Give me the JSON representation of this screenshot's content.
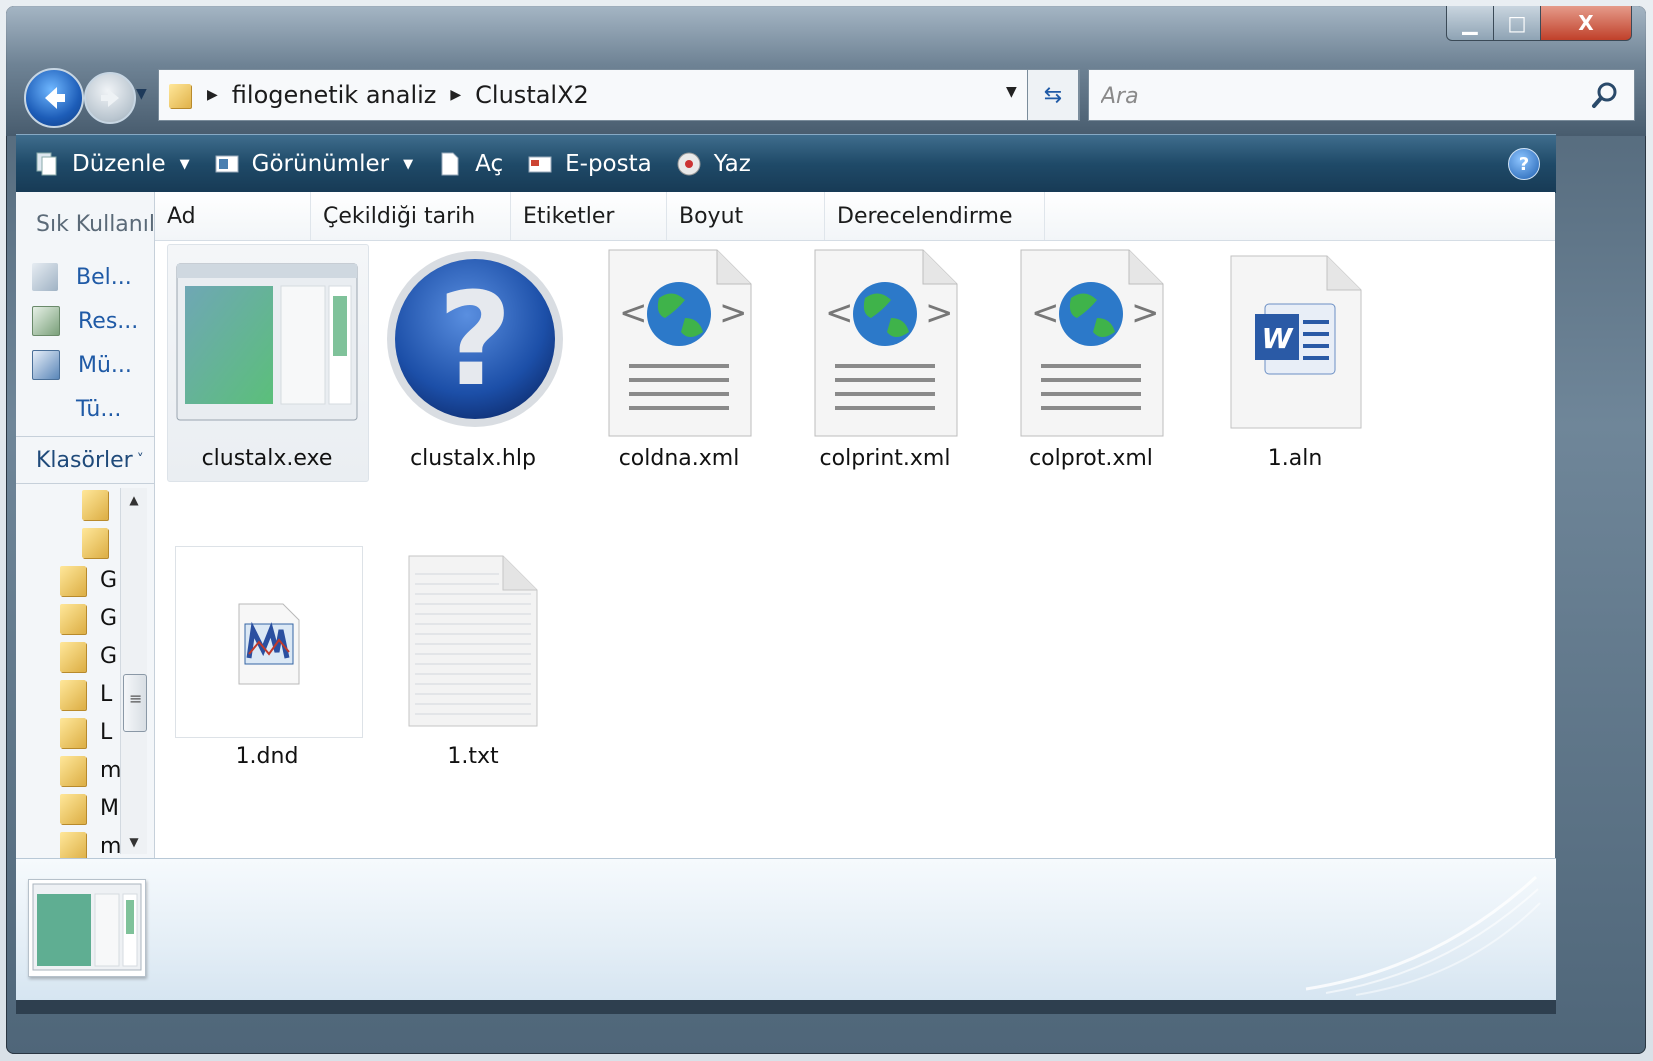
{
  "window": {
    "minimize_glyph": "▁",
    "maximize_glyph": "□",
    "close_glyph": "X"
  },
  "address": {
    "breadcrumb": [
      "filogenetik analiz",
      "ClustalX2"
    ],
    "separator_glyph": "▶",
    "dropdown_glyph": "▼",
    "refresh_glyph": "⇆"
  },
  "search": {
    "placeholder": "Ara"
  },
  "toolbar": {
    "organize_label": "Düzenle",
    "views_label": "Görünümler",
    "open_label": "Aç",
    "email_label": "E-posta",
    "print_label": "Yaz",
    "dropdown_glyph": "▼",
    "help_glyph": "?"
  },
  "navpane": {
    "favorites_title": "Sık Kullanıl",
    "favorites": [
      {
        "label": "Bel...",
        "icon": "documents-icon"
      },
      {
        "label": "Res...",
        "icon": "pictures-icon"
      },
      {
        "label": "Mü...",
        "icon": "music-icon"
      },
      {
        "label": "Tü...",
        "icon": "more-icon"
      }
    ],
    "folders_title": "Klasörler",
    "folders_toggle": "˅",
    "tree": [
      "",
      "",
      "G",
      "G",
      "G",
      "L",
      "L",
      "m",
      "M",
      "m"
    ],
    "scroll_up": "▲",
    "scroll_down": "▼"
  },
  "columns": [
    "Ad",
    "Çekildiği tarih",
    "Etiketler",
    "Boyut",
    "Derecelendirme"
  ],
  "files": [
    {
      "name": "clustalx.exe",
      "icon": "application-window-icon",
      "selected": true
    },
    {
      "name": "clustalx.hlp",
      "icon": "help-file-icon"
    },
    {
      "name": "coldna.xml",
      "icon": "xml-document-icon"
    },
    {
      "name": "colprint.xml",
      "icon": "xml-document-icon"
    },
    {
      "name": "colprot.xml",
      "icon": "xml-document-icon"
    },
    {
      "name": "1.aln",
      "icon": "word-document-icon"
    },
    {
      "name": "1.dnd",
      "icon": "tree-file-icon"
    },
    {
      "name": "1.txt",
      "icon": "text-document-icon"
    }
  ],
  "help_question_glyph": "?",
  "colors": {
    "command_bar": "#1f4a68",
    "link_blue": "#1f5aa6",
    "folder_yellow": "#e0b24a"
  }
}
